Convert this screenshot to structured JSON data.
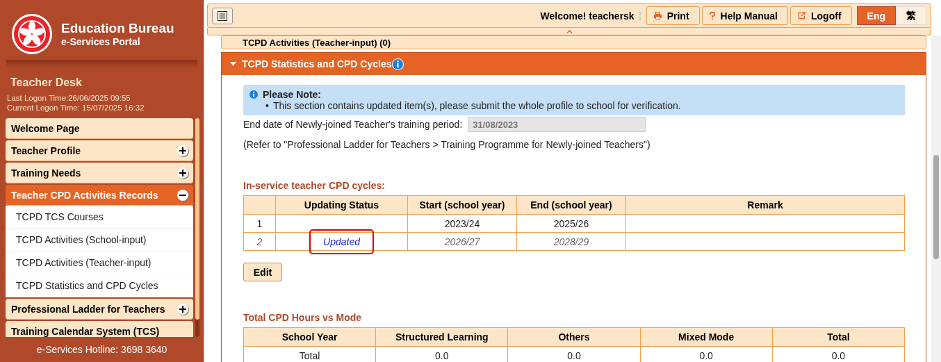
{
  "brand": {
    "title": "Education Bureau",
    "subtitle": "e-Services Portal"
  },
  "desk": {
    "title": "Teacher Desk",
    "last_logon": "Last Logon Time:26/06/2025 09:55",
    "current_logon": "Current Logon Time: 15/07/2025 16:32"
  },
  "menu": [
    {
      "label": "Welcome Page",
      "expandable": false,
      "expanded": false
    },
    {
      "label": "Teacher Profile",
      "expandable": true,
      "expanded": false
    },
    {
      "label": "Training Needs",
      "expandable": true,
      "expanded": false
    },
    {
      "label": "Teacher CPD Activities Records",
      "expandable": true,
      "expanded": true,
      "children": [
        {
          "label": "TCPD TCS Courses"
        },
        {
          "label": "TCPD Activities (School-input)"
        },
        {
          "label": "TCPD Activities (Teacher-input)"
        },
        {
          "label": "TCPD Statistics and CPD Cycles"
        }
      ]
    },
    {
      "label": "Professional Ladder for Teachers",
      "expandable": true,
      "expanded": false
    },
    {
      "label": "Training Calendar System (TCS)",
      "expandable": false,
      "expanded": false
    }
  ],
  "hotline": "e-Services Hotline: 3698 3640",
  "topbar": {
    "welcome": "Welcome! teachersk",
    "buttons": [
      {
        "label": "Print"
      },
      {
        "label": "Help Manual"
      },
      {
        "label": "Logoff"
      }
    ],
    "languages": [
      {
        "label": "Eng",
        "selected": true
      },
      {
        "label": "繁",
        "selected": false
      }
    ]
  },
  "collapsed_panel": {
    "title": "TCPD Activities (Teacher-input) (0)"
  },
  "panel": {
    "title": "TCPD Statistics and CPD Cycles",
    "note_title": "Please Note:",
    "note_bullet": "•",
    "note_items": [
      "This section contains updated item(s), please submit the whole profile to school for verification."
    ],
    "end_date_label": "End date of Newly-joined Teacher's training period:",
    "end_date_value": "31/08/2023",
    "refer": "(Refer to \"Professional Ladder for Teachers > Training Programme for Newly-joined Teachers\")",
    "cycles_title": "In-service teacher CPD cycles:",
    "cycles_columns": [
      "",
      "Updating Status",
      "Start (school year)",
      "End (school year)",
      "Remark"
    ],
    "cycles_rows": [
      {
        "no": "1",
        "status": "",
        "start": "2023/24",
        "end": "2025/26",
        "remark": "",
        "updated": false
      },
      {
        "no": "2",
        "status": "Updated",
        "start": "2026/27",
        "end": "2028/29",
        "remark": "",
        "updated": true
      }
    ],
    "edit_button": "Edit",
    "hours_title": "Total CPD Hours vs Mode",
    "hours_columns": [
      "School Year",
      "Structured Learning",
      "Others",
      "Mixed Mode",
      "Total"
    ],
    "hours_rows": [
      [
        "Total",
        "0.0",
        "0.0",
        "0.0",
        "0.0"
      ]
    ]
  }
}
